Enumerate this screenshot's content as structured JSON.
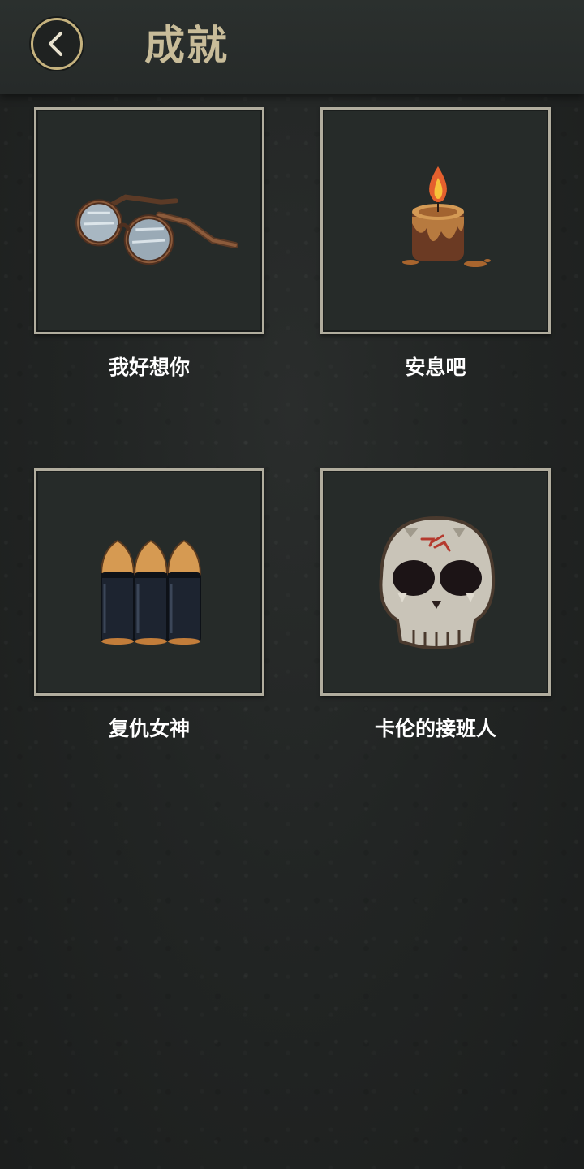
{
  "header": {
    "title": "成就",
    "back_icon": "chevron-left-icon"
  },
  "colors": {
    "accent_gold": "#c5b27e",
    "title_color": "#c8bc99",
    "card_border": "#b1ad9e",
    "background": "#222524"
  },
  "achievements": [
    {
      "label": "我好想你",
      "icon": "glasses-icon"
    },
    {
      "label": "安息吧",
      "icon": "candle-icon"
    },
    {
      "label": "复仇女神",
      "icon": "bullets-icon"
    },
    {
      "label": "卡伦的接班人",
      "icon": "skull-icon"
    }
  ]
}
